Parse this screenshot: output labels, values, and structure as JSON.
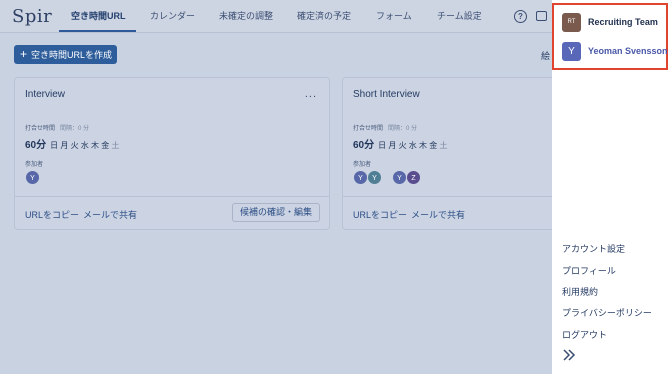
{
  "app": {
    "logo": "Spir"
  },
  "nav": {
    "tabs": [
      {
        "label": "空き時間URL",
        "active": true
      },
      {
        "label": "カレンダー"
      },
      {
        "label": "未確定の調整"
      },
      {
        "label": "確定済の予定"
      },
      {
        "label": "フォーム"
      },
      {
        "label": "チーム設定"
      }
    ],
    "help_glyph": "?"
  },
  "toolbar": {
    "create_button": "空き時間URLを作成",
    "partial_text": "絵"
  },
  "cards": [
    {
      "title": "Interview",
      "more": "...",
      "meta_label": "打合せ時間",
      "meta_gap": "間隔：0 分",
      "duration": "60分",
      "days_on": "日 月 火 水 木 金",
      "days_off": "土",
      "participants_label": "参加者",
      "avatars": [
        "Y"
      ],
      "copy_link": "URLをコピー",
      "share_link": "メールで共有",
      "candidate_button": "候補の確認・編集"
    },
    {
      "title": "Short Interview",
      "meta_label": "打合せ時間",
      "meta_gap": "間隔：0 分",
      "duration": "60分",
      "days_on": "日 月 火 水 木 金",
      "days_off": "土",
      "participants_label": "参加者",
      "avatars": [
        "Y",
        "Y",
        "Y",
        "Z"
      ],
      "copy_link": "URLをコピー",
      "share_link": "メールで共有"
    }
  ],
  "panel": {
    "accounts": [
      {
        "initials": "RT",
        "name": "Recruiting Team"
      },
      {
        "initials": "Y",
        "name": "Yeoman Svensson"
      }
    ],
    "menu": [
      "アカウント設定",
      "プロフィール",
      "利用規約",
      "プライバシーポリシー",
      "ログアウト"
    ]
  },
  "colors": {
    "accent": "#2e5d9b",
    "highlight": "#e0432e",
    "overlay_bg": "#c9d2e1"
  }
}
